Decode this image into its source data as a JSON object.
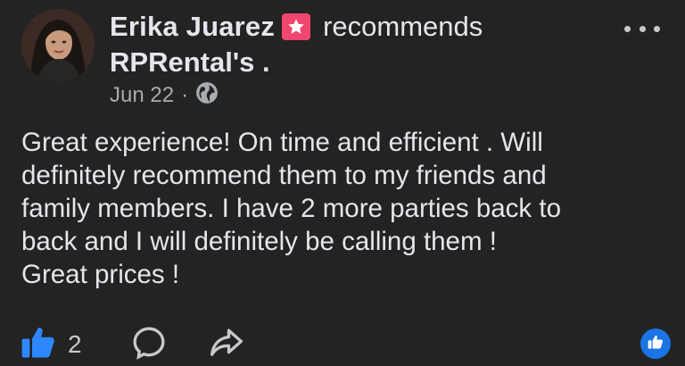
{
  "post": {
    "author": "Erika Juarez",
    "recommends_word": "recommends",
    "page_name": "RPRental's .",
    "date": "Jun 22",
    "separator": "·",
    "audience_icon": "globe-icon",
    "body_lines": [
      "Great experience! On time and efficient . Will",
      "definitely recommend them to my friends and",
      "family members. I have 2 more parties back to",
      "back and I will definitely be calling them !",
      "Great prices !"
    ]
  },
  "actions": {
    "like_count": "2",
    "like_icon": "thumbs-up-icon",
    "comment_icon": "comment-icon",
    "share_icon": "share-icon",
    "more_icon": "more-options-icon"
  },
  "colors": {
    "background": "#232323",
    "badge_pink": "#f0466f",
    "like_blue": "#1b74e4",
    "text": "#e4e6eb",
    "muted_text": "#a8abaf"
  }
}
